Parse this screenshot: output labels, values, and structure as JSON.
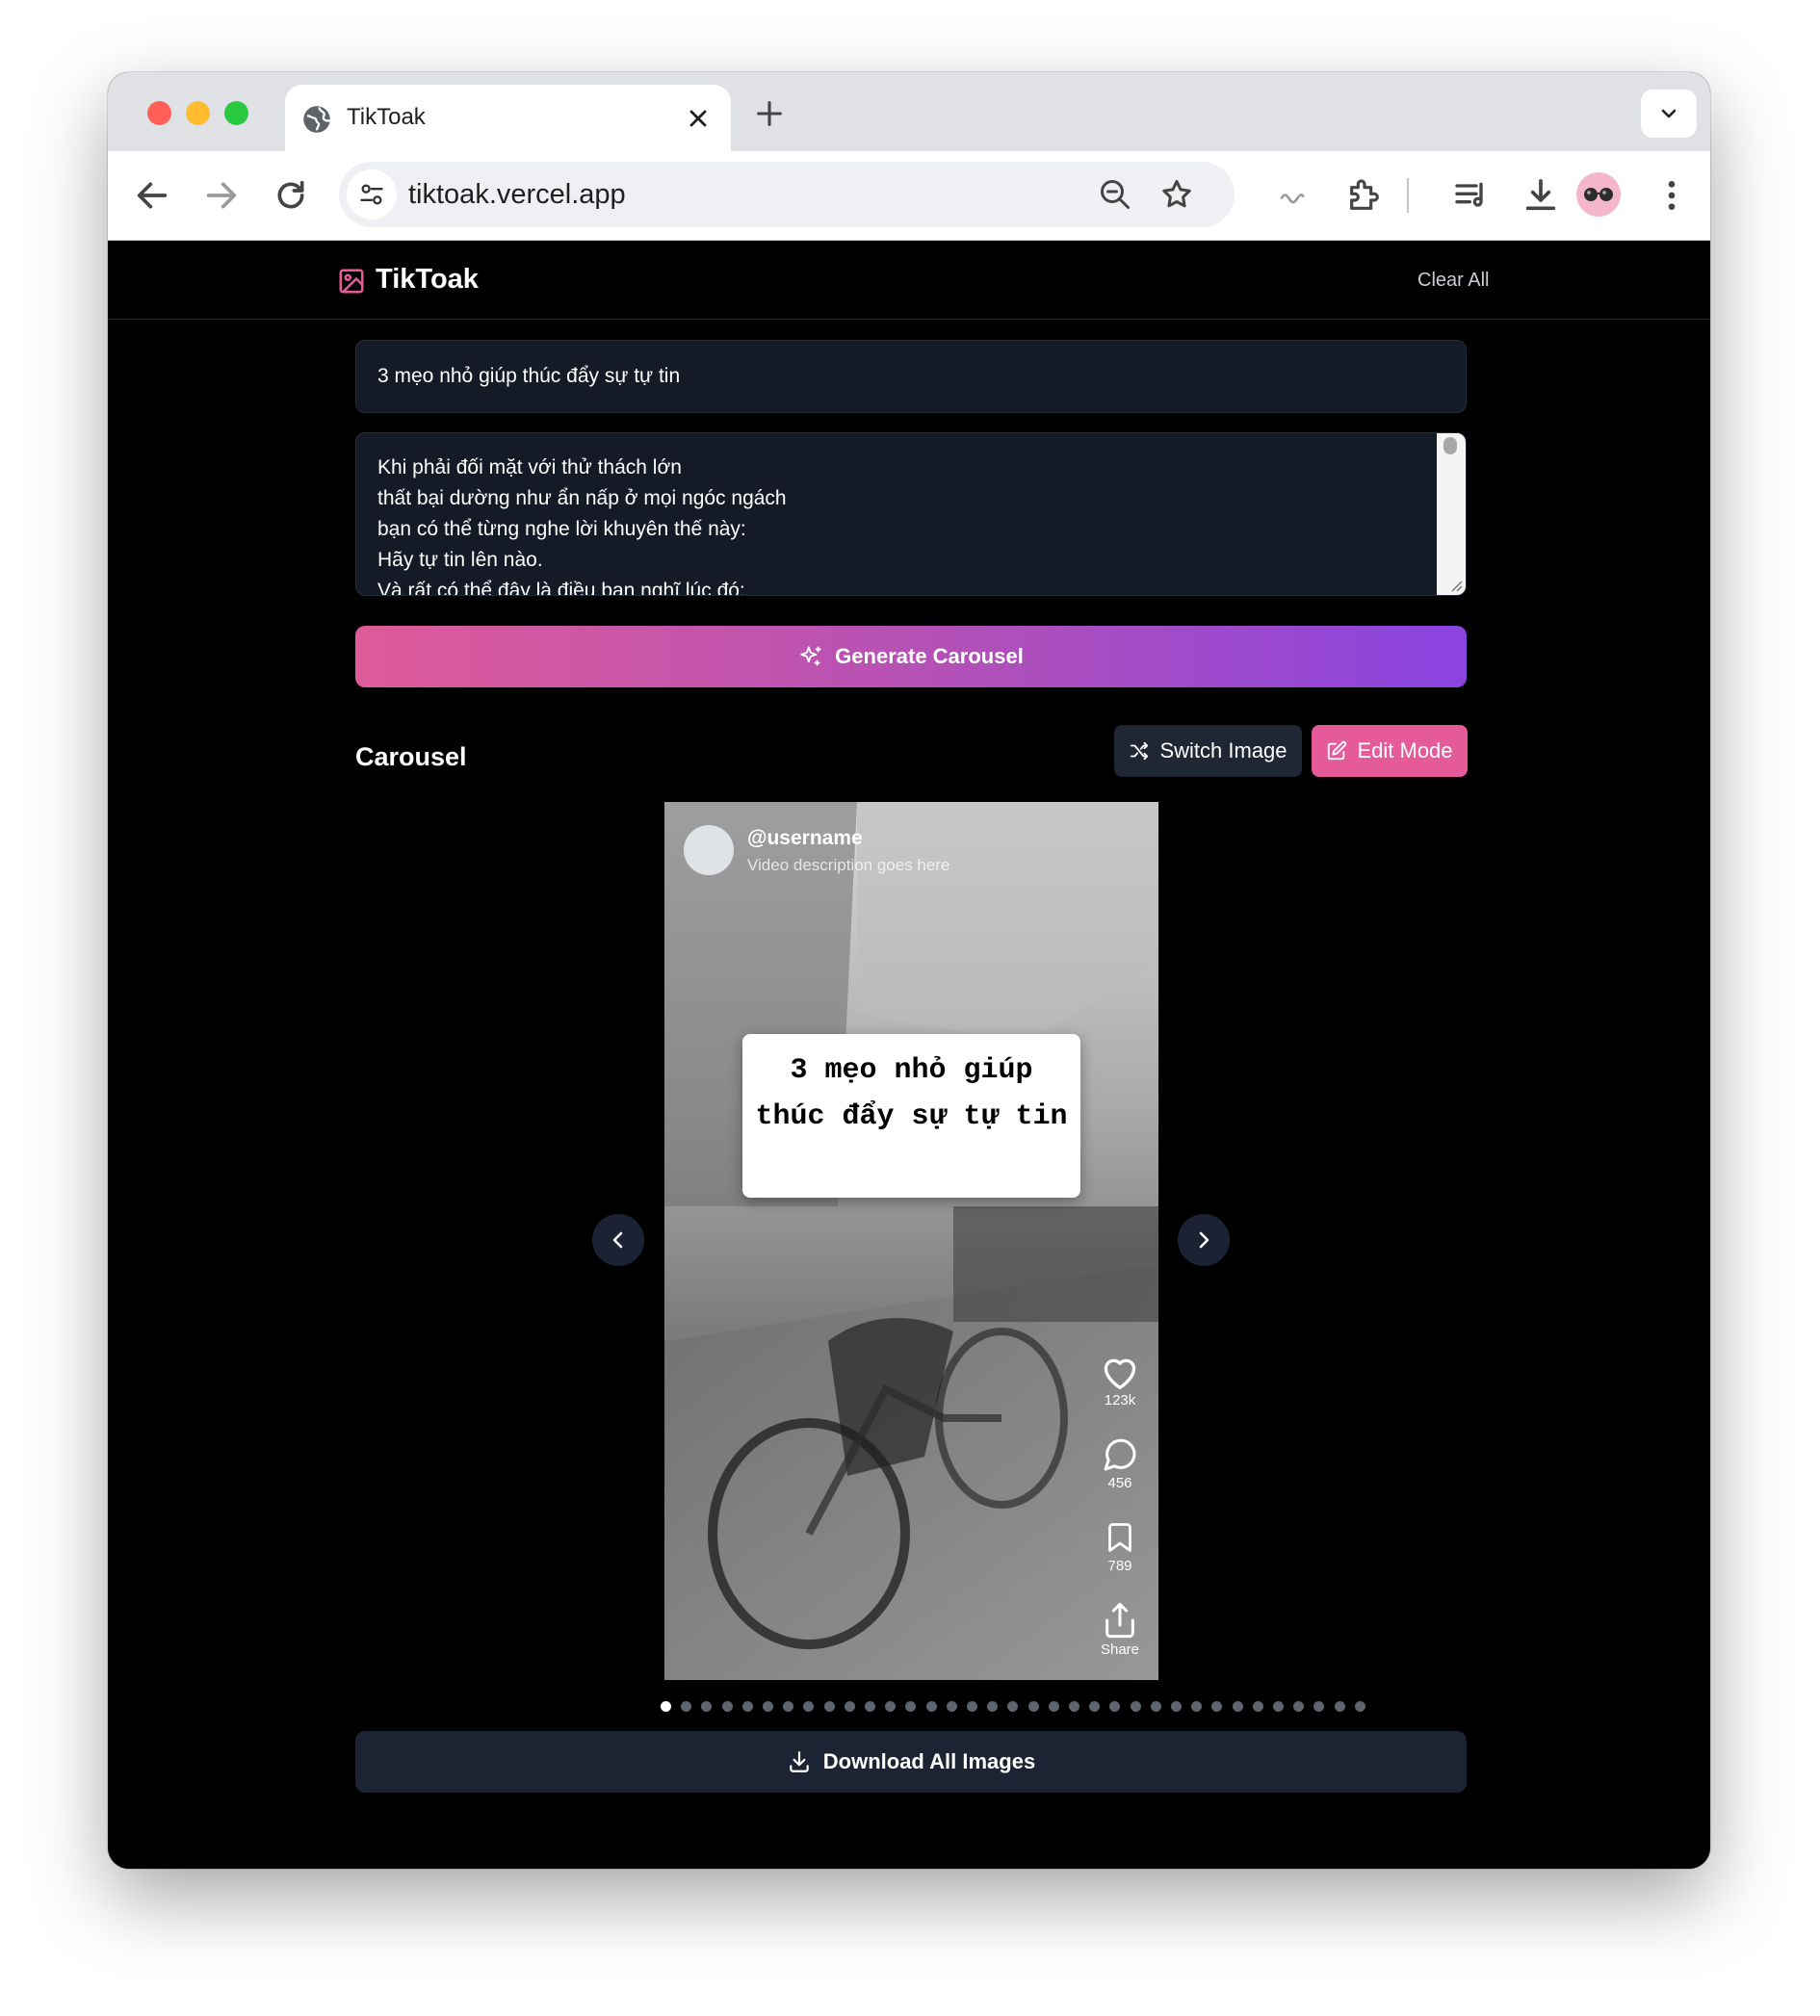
{
  "browser": {
    "tab_title": "TikToak",
    "url": "tiktoak.vercel.app"
  },
  "app": {
    "brand": "TikToak",
    "clear_all": "Clear All",
    "title_value": "3 mẹo nhỏ giúp thúc đẩy sự tự tin",
    "content_value": "Khi phải đối mặt với thử thách lớn\nthất bại dường như ẩn nấp ở mọi ngóc ngách\nbạn có thể từng nghe lời khuyên thế này:\nHãy tự tin lên nào.\nVà rất có thể đây là điều bạn nghĩ lúc đó:",
    "generate_label": "Generate Carousel",
    "section_title": "Carousel",
    "switch_image_label": "Switch Image",
    "edit_mode_label": "Edit Mode",
    "download_label": "Download All Images"
  },
  "slide": {
    "username": "@username",
    "description": "Video description goes here",
    "caption": "3 mẹo nhỏ giúp thúc đẩy sự tự tin",
    "likes": "123k",
    "comments": "456",
    "saves": "789",
    "share": "Share"
  },
  "carousel": {
    "total_slides": 35,
    "current_slide": 1
  },
  "colors": {
    "accent_pink": "#e55b9a",
    "gradient_start": "#df5b9a",
    "gradient_end": "#8a44e0",
    "page_bg": "#000000",
    "input_bg": "#141a26"
  },
  "icons": [
    "globe-icon",
    "close-icon",
    "plus-icon",
    "chevron-down-icon",
    "back-icon",
    "forward-icon",
    "reload-icon",
    "site-settings-icon",
    "zoom-out-icon",
    "star-icon",
    "extension-icon",
    "reading-list-icon",
    "download-icon",
    "more-icon",
    "image-icon",
    "sparkles-icon",
    "shuffle-icon",
    "edit-icon",
    "heart-icon",
    "comment-icon",
    "bookmark-icon",
    "share-icon",
    "chevron-left-icon",
    "chevron-right-icon"
  ]
}
